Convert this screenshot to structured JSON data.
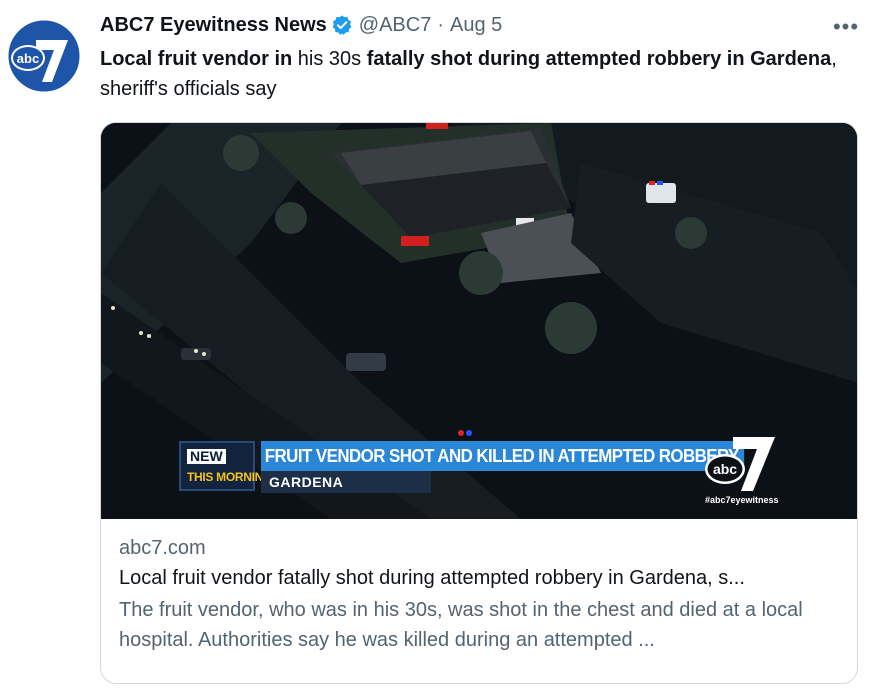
{
  "account": {
    "display_name": "ABC7 Eyewitness News",
    "handle": "@ABC7",
    "separator": "·",
    "timestamp": "Aug 5",
    "avatar_icon": "abc7-logo-icon",
    "verified_icon": "verified-badge-icon",
    "accent": "#1d9bf0"
  },
  "more_label": "•••",
  "tweet": {
    "segments": [
      {
        "text": "Local fruit vendor in",
        "bold": true
      },
      {
        "text": " his 30s ",
        "bold": false
      },
      {
        "text": "fatally shot during attempted robbery in Gardena",
        "bold": true
      },
      {
        "text": ", sheriff's officials say",
        "bold": false
      }
    ]
  },
  "card": {
    "image": {
      "tag_new": "NEW",
      "tag_this_morning": "THIS MORNING",
      "headline": "FRUIT VENDOR SHOT AND KILLED IN ATTEMPTED ROBBERY",
      "location": "GARDENA",
      "bug_text": "abc",
      "bug_number": "7",
      "hashtag": "#abc7eyewitness"
    },
    "domain": "abc7.com",
    "title": "Local fruit vendor fatally shot during attempted robbery in Gardena, s...",
    "description": "The fruit vendor, who was in his 30s, was shot in the chest and died at a local hospital. Authorities say he was killed during an attempted ..."
  }
}
